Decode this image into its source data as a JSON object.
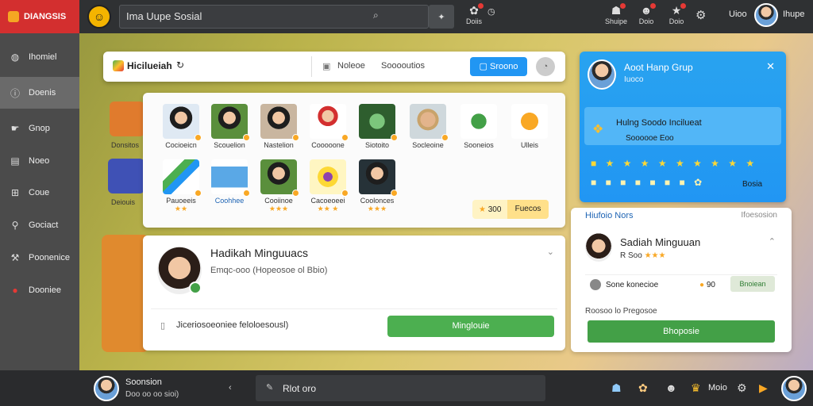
{
  "brand": {
    "name": "DIANGSIS"
  },
  "search": {
    "value": "Ima Uupe Sosial"
  },
  "top_icons": [
    {
      "label": "Doiis"
    },
    {
      "label": "Shuipe"
    },
    {
      "label": "Doio"
    },
    {
      "label": "Doio"
    }
  ],
  "top_user": {
    "label": "Uioo",
    "label2": "Ihupe"
  },
  "sidebar": {
    "items": [
      {
        "label": "Ihomiel",
        "icon": "globe-icon"
      },
      {
        "label": "Doenis",
        "icon": "info-icon"
      },
      {
        "label": "Gnop",
        "icon": "hand-icon"
      },
      {
        "label": "Noeo",
        "icon": "grid-icon"
      },
      {
        "label": "Coue",
        "icon": "plus-box-icon"
      },
      {
        "label": "Gociact",
        "icon": "pin-icon"
      },
      {
        "label": "Poonenice",
        "icon": "tool-icon"
      },
      {
        "label": "Dooniee",
        "icon": "circle-icon"
      }
    ]
  },
  "group_bar": {
    "title": "Hicilueiah",
    "notes": "Noleoe",
    "resources": "Sooooutios",
    "button": "Sroono"
  },
  "left_deco": {
    "label": "Donsitos",
    "label2": "Deiouis"
  },
  "stickers": [
    {
      "label": "Cocioeicn",
      "stars": ""
    },
    {
      "label": "Scouelion",
      "stars": ""
    },
    {
      "label": "Nastelion",
      "stars": ""
    },
    {
      "label": "Cooooone",
      "stars": ""
    },
    {
      "label": "Siotoito",
      "stars": ""
    },
    {
      "label": "Socleoine",
      "stars": ""
    },
    {
      "label": "Sooneios",
      "stars": ""
    },
    {
      "label": "Ulleis",
      "stars": ""
    },
    {
      "label": "Pauoeeis",
      "stars": "★★"
    },
    {
      "label": "Coohhee",
      "stars": ""
    },
    {
      "label": "Cooiinoe",
      "stars": "★★★"
    },
    {
      "label": "Cacoeoeei",
      "stars": "★★ ★"
    },
    {
      "label": "Coolonces",
      "stars": "★★★"
    }
  ],
  "coins": {
    "amount": "300",
    "label": "Fuecos"
  },
  "profile": {
    "name": "Hadikah Minguuacs",
    "subtitle": "Emqc-ooo (Hopeosoe ol Bbio)",
    "input_placeholder": "Jiceriosoeoniee feloloesousl)",
    "button": "Minglouie"
  },
  "right_card": {
    "title": "Aoot Hanp Grup",
    "subtitle": "Iuoco",
    "event": "Hulng Soodo Incilueat",
    "event_sub": "Soooooe Eoo",
    "bonus": "Bosia"
  },
  "right_list": {
    "header": "Hiufoio Nors",
    "header_right": "Ifoesosion",
    "name": "Sadiah Minguuan",
    "rating": "R Soo",
    "rating_stars": "★★★",
    "sub": "Sone konecioe",
    "coin_amount": "90",
    "coin_button": "Bnoiean",
    "note": "Roosoo lo Pregosoe",
    "button": "Bhoposie"
  },
  "bottom": {
    "name": "Soonsion",
    "status": "Doo oo oo sioi)",
    "chat_placeholder": "Rlot oro",
    "more": "Moio"
  },
  "colors": {
    "brand": "#d32f2f",
    "accent": "#2196f3",
    "success": "#43a047"
  }
}
